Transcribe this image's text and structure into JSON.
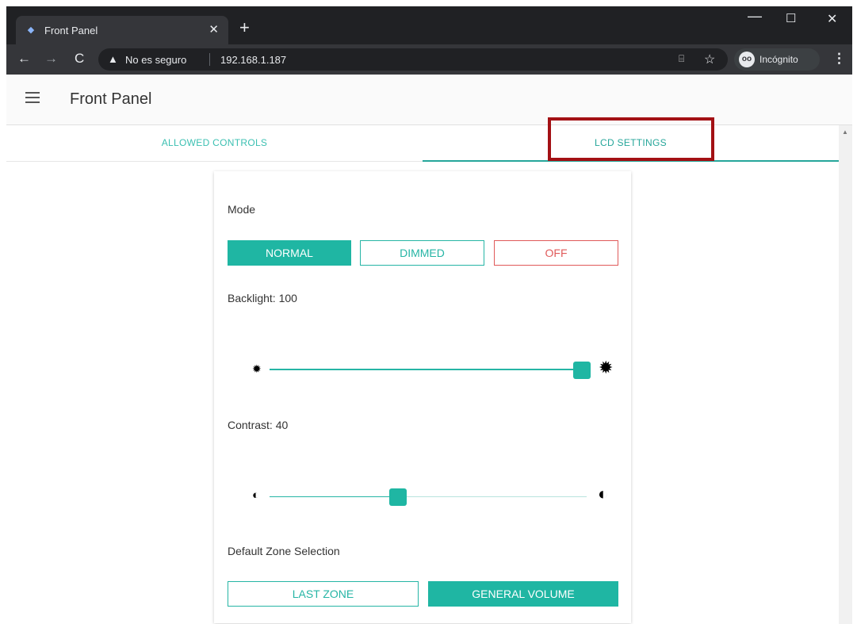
{
  "browser": {
    "tab_title": "Front Panel",
    "tab_close": "✕",
    "new_tab": "+",
    "minimize": "—",
    "maximize": "☐",
    "close": "✕",
    "back": "←",
    "forward": "→",
    "reload": "C",
    "insecure_label": "No es seguro",
    "url": "192.168.1.187",
    "incognito_label": "Incógnito",
    "menu": "⋮"
  },
  "app": {
    "title": "Front Panel",
    "tabs": [
      {
        "label": "ALLOWED CONTROLS"
      },
      {
        "label": "LCD SETTINGS"
      }
    ],
    "accent_color": "#1fb6a3",
    "highlight_color": "#a31014"
  },
  "lcd": {
    "mode_label": "Mode",
    "mode_buttons": [
      {
        "label": "NORMAL",
        "selected": true
      },
      {
        "label": "DIMMED",
        "selected": false
      },
      {
        "label": "OFF",
        "selected": false
      }
    ],
    "backlight_label": "Backlight: 100",
    "backlight_value": 100,
    "contrast_label": "Contrast: 40",
    "contrast_value": 40,
    "zone_label": "Default Zone Selection",
    "zone_buttons": [
      {
        "label": "LAST ZONE",
        "selected": false
      },
      {
        "label": "GENERAL VOLUME",
        "selected": true
      }
    ]
  }
}
